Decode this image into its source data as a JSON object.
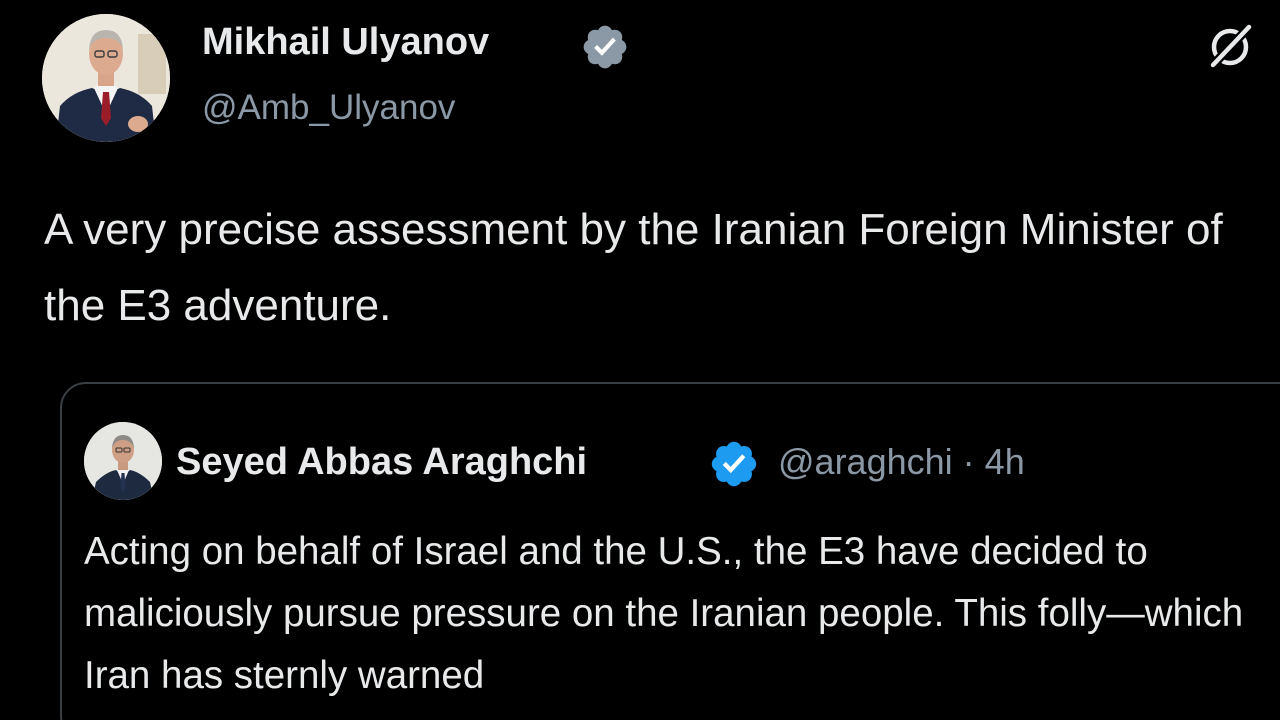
{
  "post": {
    "author": {
      "display_name": "Mikhail Ulyanov",
      "handle": "@Amb_Ulyanov",
      "verified": true,
      "verified_badge_color": "#8b98a5"
    },
    "grok_icon": "grok-slash-circle-icon",
    "text": "A very precise assessment by the Iranian Foreign Minister of the E3 adventure.",
    "quoted_post": {
      "author": {
        "display_name": "Seyed Abbas Araghchi",
        "handle": "@araghchi",
        "verified": true,
        "verified_badge_color": "#1d9bf0"
      },
      "time_ago": "4h",
      "separator": "·",
      "text": "Acting on behalf of Israel and the U.S., the E3 have decided to maliciously pursue pressure on the Iranian people. This folly—which Iran has sternly warned"
    }
  },
  "theme": {
    "background": "#000000",
    "primary_text": "#e7e9ea",
    "secondary_text": "#8b98a5",
    "card_border": "#3a3f44"
  }
}
